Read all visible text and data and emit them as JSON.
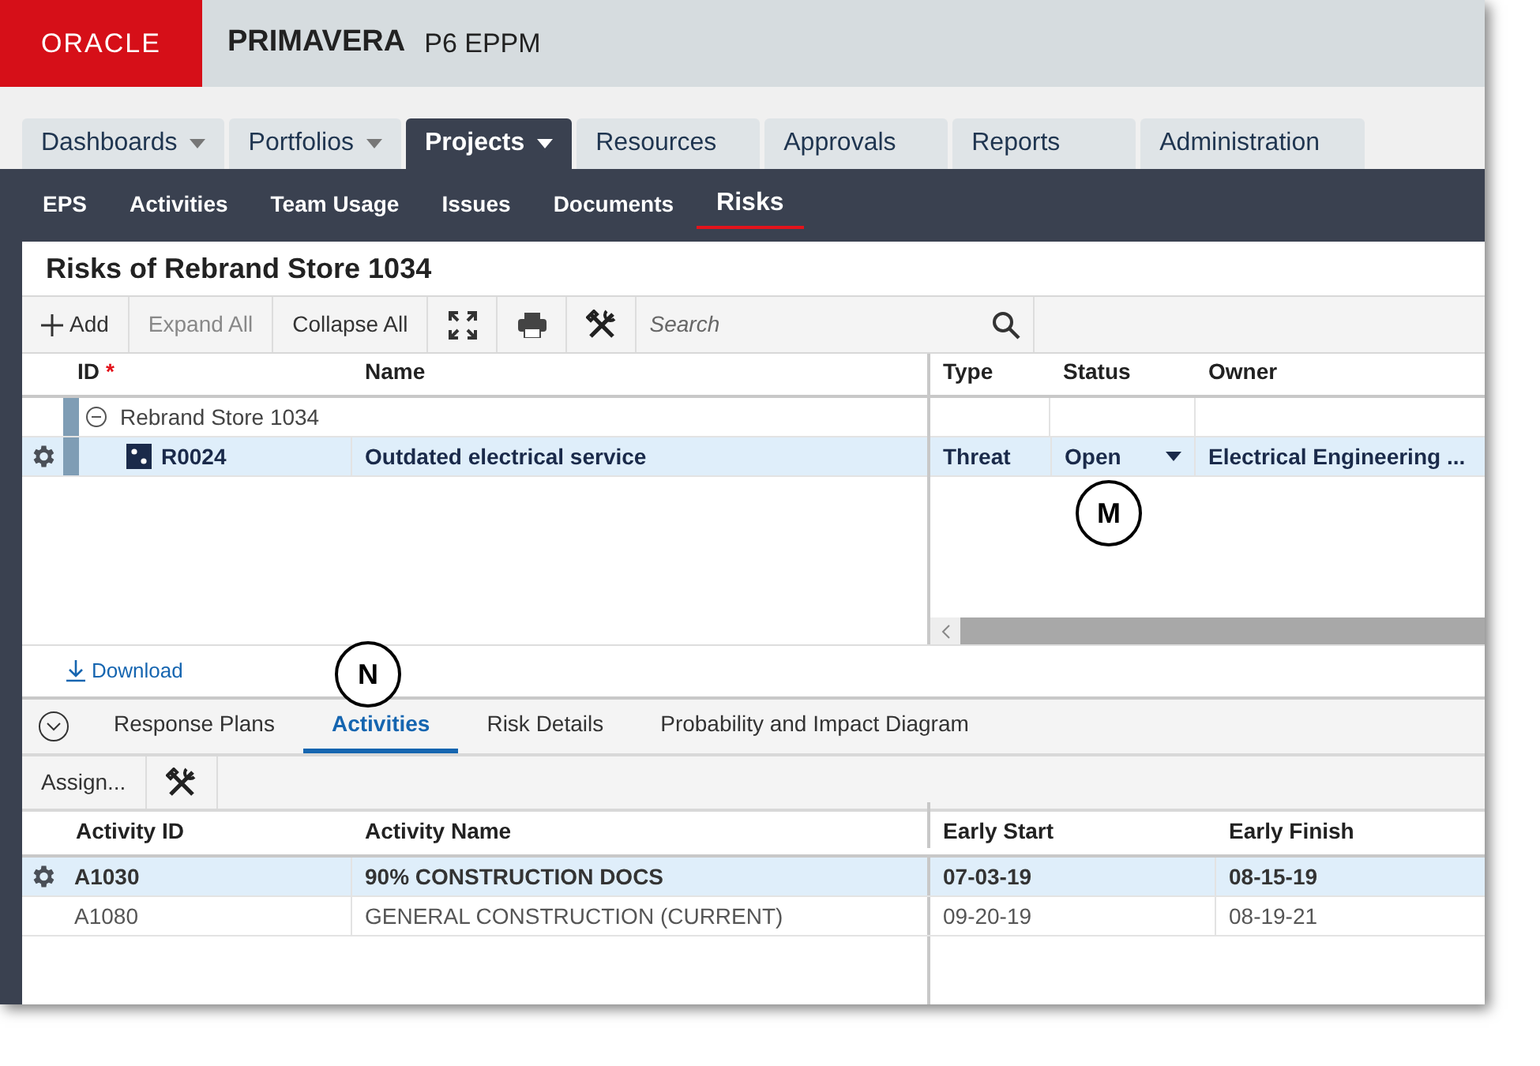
{
  "header": {
    "logo": "ORACLE",
    "product": "PRIMAVERA",
    "edition": "P6 EPPM"
  },
  "main_tabs": [
    {
      "label": "Dashboards",
      "has_menu": true,
      "selected": false
    },
    {
      "label": "Portfolios",
      "has_menu": true,
      "selected": false
    },
    {
      "label": "Projects",
      "has_menu": true,
      "selected": true
    },
    {
      "label": "Resources",
      "has_menu": false,
      "selected": false
    },
    {
      "label": "Approvals",
      "has_menu": false,
      "selected": false
    },
    {
      "label": "Reports",
      "has_menu": false,
      "selected": false
    },
    {
      "label": "Administration",
      "has_menu": false,
      "selected": false
    }
  ],
  "sub_nav": [
    {
      "label": "EPS",
      "selected": false
    },
    {
      "label": "Activities",
      "selected": false
    },
    {
      "label": "Team Usage",
      "selected": false
    },
    {
      "label": "Issues",
      "selected": false
    },
    {
      "label": "Documents",
      "selected": false
    },
    {
      "label": "Risks",
      "selected": true
    }
  ],
  "panel_title": "Risks of Rebrand Store 1034",
  "toolbar": {
    "add": "Add",
    "buttons": [
      {
        "label": "Expand All",
        "disabled": true
      },
      {
        "label": "Collapse All",
        "disabled": false
      }
    ],
    "search": {
      "placeholder": "Search"
    }
  },
  "risks_table": {
    "columns": [
      {
        "label": "ID",
        "required_mark": "*"
      },
      {
        "label": "Name"
      },
      {
        "label": "Type"
      },
      {
        "label": "Status"
      },
      {
        "label": "Owner"
      }
    ],
    "group": {
      "label": "Rebrand Store 1034",
      "expanded": true
    },
    "rows": [
      {
        "id": "R0024",
        "name": "Outdated electrical service",
        "type": "Threat",
        "status": "Open",
        "owner": "Electrical Engineering ...",
        "selected": true
      }
    ],
    "callout": "M"
  },
  "download": {
    "label": "Download",
    "callout": "N"
  },
  "detail_tabs": [
    {
      "label": "Response Plans",
      "selected": false
    },
    {
      "label": "Activities",
      "selected": true
    },
    {
      "label": "Risk Details",
      "selected": false
    },
    {
      "label": "Probability and Impact Diagram",
      "selected": false
    }
  ],
  "detail_toolbar": {
    "assign": "Assign..."
  },
  "activities_table": {
    "columns": [
      "Activity ID",
      "Activity Name",
      "Early Start",
      "Early Finish"
    ],
    "rows": [
      {
        "id": "A1030",
        "name": "90% CONSTRUCTION DOCS",
        "start": "07-03-19",
        "finish": "08-15-19",
        "selected": true
      },
      {
        "id": "A1080",
        "name": "GENERAL CONSTRUCTION (CURRENT)",
        "start": "09-20-19",
        "finish": "08-19-21",
        "selected": false
      }
    ]
  }
}
